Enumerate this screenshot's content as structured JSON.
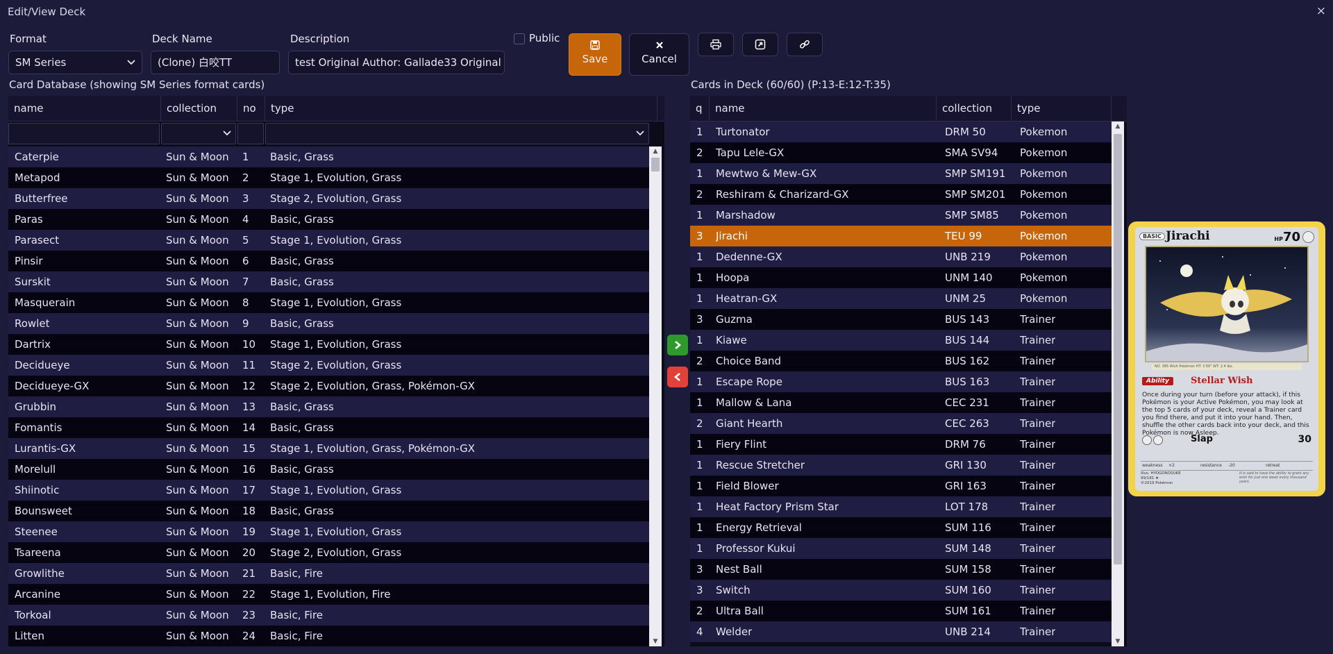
{
  "window": {
    "title": "Edit/View Deck",
    "close_glyph": "×"
  },
  "form": {
    "format_label": "Format",
    "format_value": "SM Series",
    "deckname_label": "Deck Name",
    "deckname_value": "(Clone) 白咬TT",
    "description_label": "Description",
    "description_value": "test Original Author: Gallade33 Original Author",
    "public_label": "Public",
    "public_checked": false
  },
  "toolbar": {
    "save_label": "Save",
    "cancel_label": "Cancel",
    "icons": [
      "save-icon",
      "close-icon",
      "print-icon",
      "export-icon",
      "link-icon"
    ]
  },
  "database": {
    "title": "Card Database (showing SM Series format cards)",
    "columns": [
      "name",
      "collection",
      "no",
      "type"
    ],
    "rows": [
      [
        "Caterpie",
        "Sun & Moon",
        "1",
        "Basic, Grass"
      ],
      [
        "Metapod",
        "Sun & Moon",
        "2",
        "Stage 1, Evolution, Grass"
      ],
      [
        "Butterfree",
        "Sun & Moon",
        "3",
        "Stage 2, Evolution, Grass"
      ],
      [
        "Paras",
        "Sun & Moon",
        "4",
        "Basic, Grass"
      ],
      [
        "Parasect",
        "Sun & Moon",
        "5",
        "Stage 1, Evolution, Grass"
      ],
      [
        "Pinsir",
        "Sun & Moon",
        "6",
        "Basic, Grass"
      ],
      [
        "Surskit",
        "Sun & Moon",
        "7",
        "Basic, Grass"
      ],
      [
        "Masquerain",
        "Sun & Moon",
        "8",
        "Stage 1, Evolution, Grass"
      ],
      [
        "Rowlet",
        "Sun & Moon",
        "9",
        "Basic, Grass"
      ],
      [
        "Dartrix",
        "Sun & Moon",
        "10",
        "Stage 1, Evolution, Grass"
      ],
      [
        "Decidueye",
        "Sun & Moon",
        "11",
        "Stage 2, Evolution, Grass"
      ],
      [
        "Decidueye-GX",
        "Sun & Moon",
        "12",
        "Stage 2, Evolution, Grass, Pokémon-GX"
      ],
      [
        "Grubbin",
        "Sun & Moon",
        "13",
        "Basic, Grass"
      ],
      [
        "Fomantis",
        "Sun & Moon",
        "14",
        "Basic, Grass"
      ],
      [
        "Lurantis-GX",
        "Sun & Moon",
        "15",
        "Stage 1, Evolution, Grass, Pokémon-GX"
      ],
      [
        "Morelull",
        "Sun & Moon",
        "16",
        "Basic, Grass"
      ],
      [
        "Shiinotic",
        "Sun & Moon",
        "17",
        "Stage 1, Evolution, Grass"
      ],
      [
        "Bounsweet",
        "Sun & Moon",
        "18",
        "Basic, Grass"
      ],
      [
        "Steenee",
        "Sun & Moon",
        "19",
        "Stage 1, Evolution, Grass"
      ],
      [
        "Tsareena",
        "Sun & Moon",
        "20",
        "Stage 2, Evolution, Grass"
      ],
      [
        "Growlithe",
        "Sun & Moon",
        "21",
        "Basic, Fire"
      ],
      [
        "Arcanine",
        "Sun & Moon",
        "22",
        "Stage 1, Evolution, Fire"
      ],
      [
        "Torkoal",
        "Sun & Moon",
        "23",
        "Basic, Fire"
      ],
      [
        "Litten",
        "Sun & Moon",
        "24",
        "Basic, Fire"
      ]
    ]
  },
  "deck": {
    "title": "Cards in Deck (60/60) (P:13-E:12-T:35)",
    "columns": [
      "q",
      "name",
      "collection",
      "type"
    ],
    "selected_index": 5,
    "rows": [
      [
        "1",
        "Turtonator",
        "DRM 50",
        "Pokemon"
      ],
      [
        "2",
        "Tapu Lele-GX",
        "SMA SV94",
        "Pokemon"
      ],
      [
        "1",
        "Mewtwo & Mew-GX",
        "SMP SM191",
        "Pokemon"
      ],
      [
        "2",
        "Reshiram & Charizard-GX",
        "SMP SM201",
        "Pokemon"
      ],
      [
        "1",
        "Marshadow",
        "SMP SM85",
        "Pokemon"
      ],
      [
        "3",
        "Jirachi",
        "TEU 99",
        "Pokemon"
      ],
      [
        "1",
        "Dedenne-GX",
        "UNB 219",
        "Pokemon"
      ],
      [
        "1",
        "Hoopa",
        "UNM 140",
        "Pokemon"
      ],
      [
        "1",
        "Heatran-GX",
        "UNM 25",
        "Pokemon"
      ],
      [
        "3",
        "Guzma",
        "BUS 143",
        "Trainer"
      ],
      [
        "1",
        "Kiawe",
        "BUS 144",
        "Trainer"
      ],
      [
        "2",
        "Choice Band",
        "BUS 162",
        "Trainer"
      ],
      [
        "1",
        "Escape Rope",
        "BUS 163",
        "Trainer"
      ],
      [
        "1",
        "Mallow & Lana",
        "CEC 231",
        "Trainer"
      ],
      [
        "2",
        "Giant Hearth",
        "CEC 263",
        "Trainer"
      ],
      [
        "1",
        "Fiery Flint",
        "DRM 76",
        "Trainer"
      ],
      [
        "1",
        "Rescue Stretcher",
        "GRI 130",
        "Trainer"
      ],
      [
        "1",
        "Field Blower",
        "GRI 163",
        "Trainer"
      ],
      [
        "1",
        "Heat Factory Prism Star",
        "LOT 178",
        "Trainer"
      ],
      [
        "1",
        "Energy Retrieval",
        "SUM 116",
        "Trainer"
      ],
      [
        "1",
        "Professor Kukui",
        "SUM 148",
        "Trainer"
      ],
      [
        "3",
        "Nest Ball",
        "SUM 158",
        "Trainer"
      ],
      [
        "3",
        "Switch",
        "SUM 160",
        "Trainer"
      ],
      [
        "2",
        "Ultra Ball",
        "SUM 161",
        "Trainer"
      ],
      [
        "4",
        "Welder",
        "UNB 214",
        "Trainer"
      ]
    ]
  },
  "card": {
    "stage": "BASIC",
    "name": "Jirachi",
    "hp_prefix": "HP",
    "hp": "70",
    "info_line": "NO. 385  Wish Pokémon  HT: 1'00\"  WT: 2.4 lbs.",
    "ability_tag": "Ability",
    "ability_name": "Stellar Wish",
    "ability_text": "Once during your turn (before your attack), if this Pokémon is your Active Pokémon, you may look at the top 5 cards of your deck, reveal a Trainer card you find there, and put it into your hand. Then, shuffle the other cards back into your deck, and this Pokémon is now Asleep.",
    "attack_name": "Slap",
    "attack_damage": "30",
    "weakness_label": "weakness",
    "weakness_value": "×2",
    "resistance_label": "resistance",
    "resistance_value": "-20",
    "retreat_label": "retreat",
    "illustrator": "Illus. HYOGONOSUKE",
    "number": "99/181 ★",
    "copyright": "©2019 Pokémon",
    "flavor": "It is said to have the ability to grant any wish for just one week every thousand years."
  },
  "colors": {
    "background": "#1d1b3a",
    "accent_orange": "#c7650a",
    "add_button": "#2e9a2b",
    "remove_button": "#e0423a",
    "card_border": "#f2d34a"
  }
}
